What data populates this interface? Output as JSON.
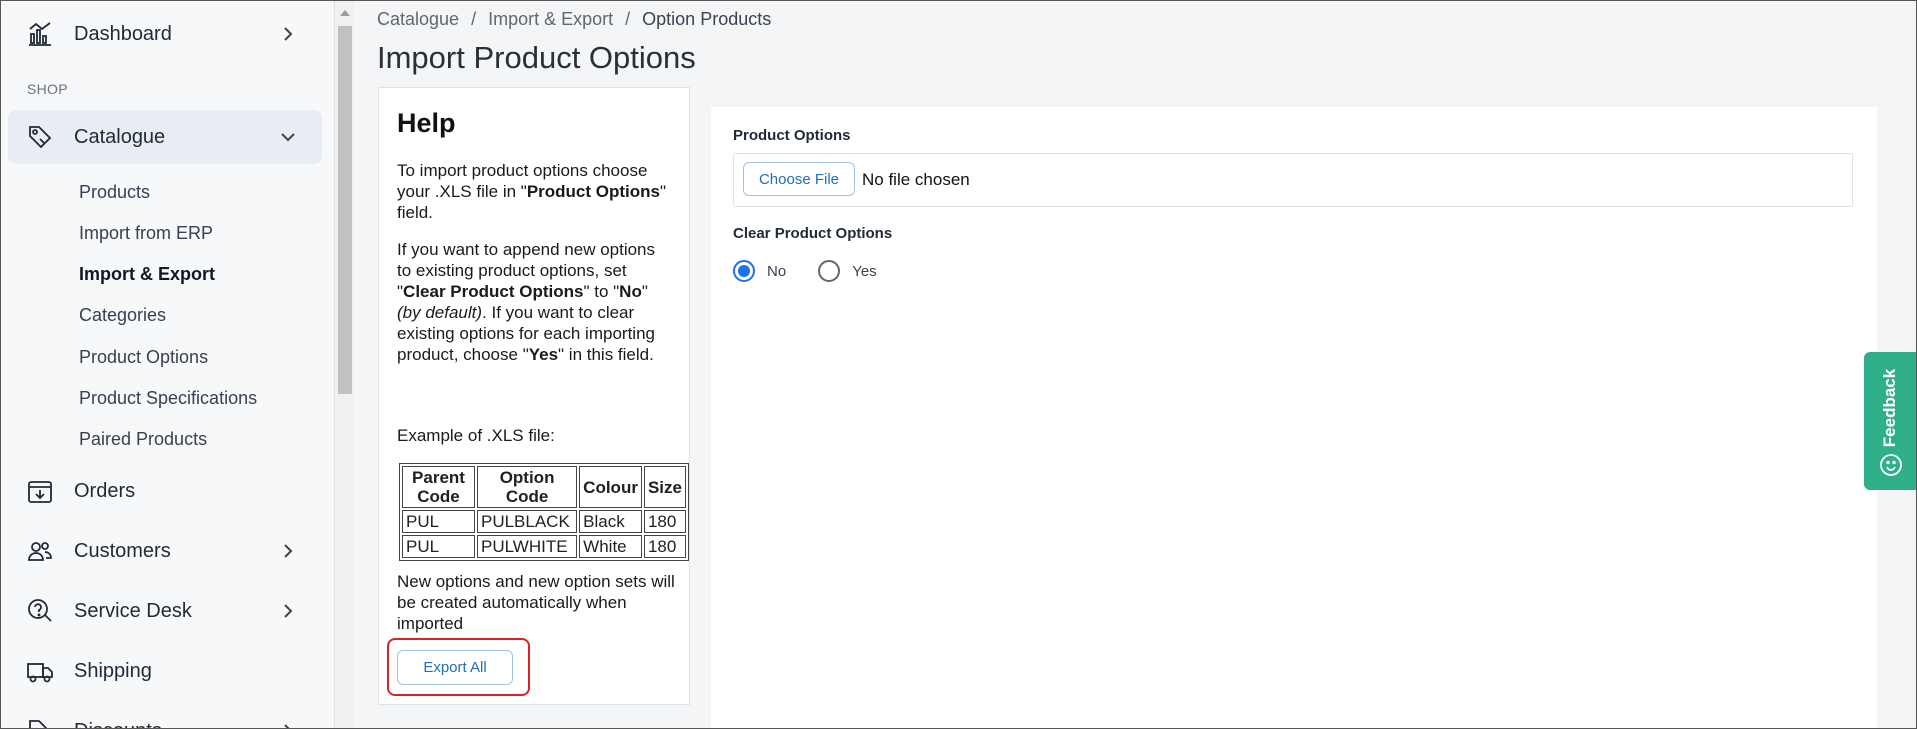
{
  "sidebar": {
    "dashboard": "Dashboard",
    "section_shop": "SHOP",
    "catalogue": "Catalogue",
    "catalogue_items": [
      "Products",
      "Import from ERP",
      "Import & Export",
      "Categories",
      "Product Options",
      "Product Specifications",
      "Paired Products"
    ],
    "orders": "Orders",
    "customers": "Customers",
    "service_desk": "Service Desk",
    "shipping": "Shipping",
    "discounts": "Discounts"
  },
  "breadcrumb": [
    "Catalogue",
    "Import & Export",
    "Option Products"
  ],
  "page_title": "Import Product Options",
  "help": {
    "title": "Help",
    "p1_a": "To import product options choose your .XLS file in \"",
    "p1_b": "Product Options",
    "p1_c": "\" field.",
    "p2_a": "If you want to append new options to existing product options, set \"",
    "p2_b": "Clear Product Options",
    "p2_c": "\" to \"",
    "p2_d": "No",
    "p2_e": "\" ",
    "p2_f": "(by default)",
    "p2_g": ". If you want to clear existing options for each importing product, choose \"",
    "p2_h": "Yes",
    "p2_i": "\" in this field.",
    "example_label": "Example of .XLS file:",
    "table_headers": [
      "Parent Code",
      "Option Code",
      "Colour",
      "Size"
    ],
    "table_rows": [
      [
        "PUL",
        "PULBLACK",
        "Black",
        "180"
      ],
      [
        "PUL",
        "PULWHITE",
        "White",
        "180"
      ]
    ],
    "footer_note": "New options and new option sets will be created automatically when imported",
    "export_button": "Export All"
  },
  "form": {
    "product_options_label": "Product Options",
    "choose_file_button": "Choose File",
    "file_status": "No file chosen",
    "clear_label": "Clear Product Options",
    "radio_no": "No",
    "radio_yes": "Yes",
    "selected": "No"
  },
  "feedback": "Feedback",
  "colors": {
    "accent": "#1a73e8",
    "feedback": "#2fb08a",
    "highlight": "#d8232a"
  }
}
